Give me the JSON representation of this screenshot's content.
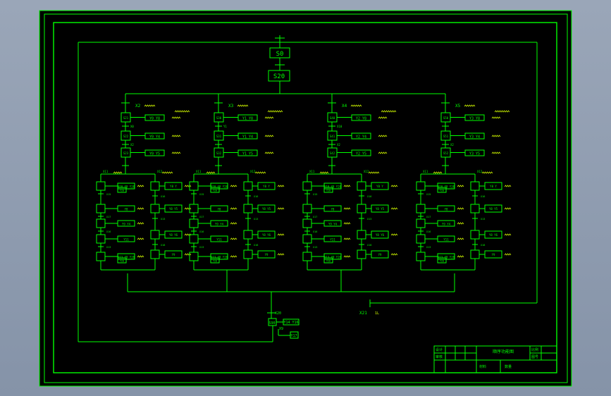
{
  "colors": {
    "background": "#000000",
    "page_outside": "#8c99ad",
    "line": "#00ff00",
    "text": "#00ff00",
    "annotation": "#d6ff00"
  },
  "top_chain": {
    "initial_step": "S0",
    "step2": "S20"
  },
  "branches": [
    {
      "cond": "X2",
      "steps": [
        {
          "label": "S21",
          "action": "Y0 Y8",
          "cond_after": "X0"
        },
        {
          "label": "S22",
          "action": "Y0 Y4",
          "cond_after": "X2"
        },
        {
          "label": "S23",
          "action": "Y0 Y5",
          "cond_after": ""
        }
      ]
    },
    {
      "cond": "X3",
      "steps": [
        {
          "label": "S30",
          "action": "Y1 Y8",
          "cond_after": "Y1"
        },
        {
          "label": "S31",
          "action": "Y1 Y4",
          "cond_after": ""
        },
        {
          "label": "S32",
          "action": "Y1 Y5",
          "cond_after": ""
        }
      ]
    },
    {
      "cond": "X4",
      "steps": [
        {
          "label": "S40",
          "action": "Y2 Y8",
          "cond_after": "X10"
        },
        {
          "label": "S41",
          "action": "Y2 Y4",
          "cond_after": "X2"
        },
        {
          "label": "S42",
          "action": "Y2 Y5",
          "cond_after": ""
        }
      ]
    },
    {
      "cond": "X5",
      "steps": [
        {
          "label": "S50",
          "action": "Y3 Y8",
          "cond_after": ""
        },
        {
          "label": "S51",
          "action": "Y3 Y4",
          "cond_after": "X2"
        },
        {
          "label": "S52",
          "action": "Y3 Y5",
          "cond_after": ""
        }
      ]
    }
  ],
  "sub_labels": {
    "left_cond": "X11",
    "right_cond": "X12",
    "left_top_action": "Y10 Y8 Y20",
    "left_top_sub": "Y20",
    "left_mid_action": "Y8",
    "left_mid2_action": "Y9 Y4",
    "left_low_action": "Y11",
    "left_bottom_action": "Y13 Y9 Y20",
    "left_bottom_sub": "Y20",
    "right_top_action": "Y8 Y",
    "right_mid_action": "Y8 Y5",
    "right_mid2_action": "Y8 Y6",
    "right_bottom_action": "Y9",
    "cond_labels": [
      "X15",
      "X17",
      "X16",
      "X13",
      "X18"
    ]
  },
  "final": {
    "cond_right": "X21",
    "cond_right_note": "1L",
    "cond_top": "X20",
    "step": "S90",
    "action": "Y14 Y16",
    "cond_after": "X9",
    "sub_action": "Y17"
  },
  "title_block": {
    "label_1": "设计",
    "label_2": "审核",
    "title": "顺序功能图",
    "label_3": "比例",
    "label_4": "图号",
    "label_5": "材料",
    "label_6": "数量"
  }
}
